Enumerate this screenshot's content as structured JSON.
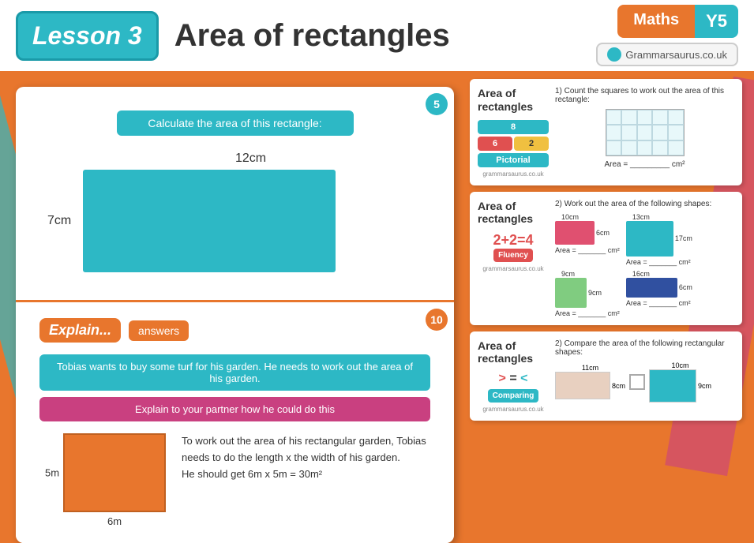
{
  "header": {
    "lesson_label": "Lesson 3",
    "title": "Area of rectangles",
    "subject": "Maths",
    "year": "Y5",
    "site": "Grammarsaurus.co.uk"
  },
  "slide1": {
    "number": "5",
    "instruction": "Calculate the area of this rectangle:",
    "width_label": "12cm",
    "height_label": "7cm"
  },
  "slide2": {
    "number": "10",
    "explain_label": "Explain...",
    "answers_label": "answers",
    "problem": "Tobias wants to buy some turf for his garden. He needs to work out the area of his garden.",
    "task": "Explain to your partner how he could do this",
    "explanation": "To work out the area of his rectangular garden, Tobias needs to do the length x the width of his garden.",
    "answer": "He should get 6m x 5m = 30m²",
    "side_label": "5m",
    "bottom_label": "6m"
  },
  "worksheet1": {
    "title": "Area of rectangles",
    "badges": [
      "8",
      "6",
      "2"
    ],
    "badge_label": "Pictorial",
    "question": "1) Count the squares to work out the area of this rectangle:",
    "area_answer": "Area = _________ cm²",
    "footer": "grammarsaurus.co.uk"
  },
  "worksheet2": {
    "title": "Area of rectangles",
    "fluency_text": "2+2=4",
    "fluency_label": "Fluency",
    "question": "2) Work out the area of the following shapes:",
    "shapes": [
      {
        "label_top": "10cm",
        "label_side": "6cm",
        "color": "pink",
        "area": "Area = _______ cm²"
      },
      {
        "label_top": "13cm",
        "label_side": "17cm",
        "color": "teal",
        "area": "Area = _______ cm²"
      },
      {
        "label_top": "9cm",
        "label_side": "9cm",
        "color": "green",
        "area": "Area = _______ cm²"
      },
      {
        "label_top": "16cm",
        "label_side": "6cm",
        "color": "navy",
        "area": "Area = _______ cm²"
      }
    ],
    "footer": "grammarsaurus.co.uk"
  },
  "worksheet3": {
    "title": "Area of rectangles",
    "comparing_label": "Comparing",
    "question": "2) Compare the area of the following rectangular shapes:",
    "rect1": {
      "width": "11cm",
      "height": "8cm"
    },
    "rect2": {
      "width": "10cm",
      "height": "9cm"
    },
    "footer": "grammarsaurus.co.uk"
  }
}
